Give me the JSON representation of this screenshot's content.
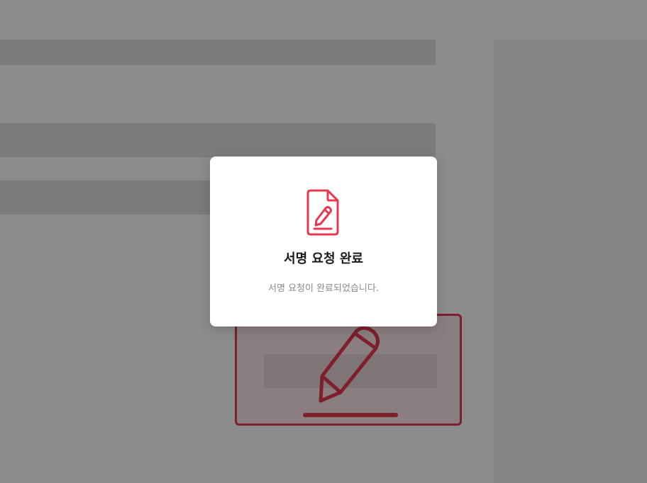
{
  "modal": {
    "title": "서명 요청 완료",
    "message": "서명 요청이 완료되었습니다.",
    "icon": "document-signature-icon",
    "accent_color": "#e53950"
  },
  "background": {
    "overlay_color": "rgba(0,0,0,0.45)",
    "signature_field_color": "#e53950",
    "signature_field_icon": "pen-signature-icon"
  }
}
